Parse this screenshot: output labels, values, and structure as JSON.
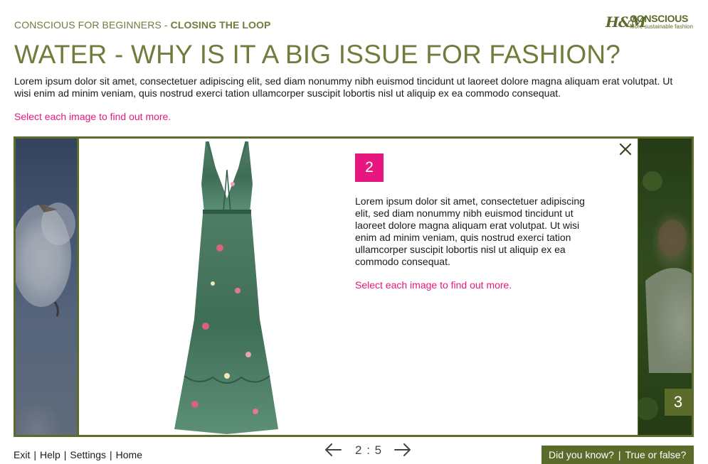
{
  "header": {
    "course": "CONSCIOUS FOR BEGINNERS",
    "separator": " - ",
    "module": "CLOSING THE LOOP",
    "logo_hm": "H&M",
    "logo_brand": "CONSCIOUS",
    "logo_tagline": "More sustainable fashion"
  },
  "page": {
    "title": "WATER - WHY IS IT A BIG ISSUE FOR FASHION?",
    "intro": "Lorem ipsum dolor sit amet, consectetuer adipiscing elit, sed diam nonummy nibh euismod tincidunt ut laoreet dolore magna aliquam erat volutpat. Ut wisi enim ad minim veniam, quis nostrud exerci tation ullamcorper suscipit lobortis nisl ut aliquip ex ea commodo consequat.",
    "hint": "Select each image to find out more."
  },
  "carousel": {
    "active_number": "2",
    "next_number": "3",
    "panel_text": "Lorem ipsum dolor sit amet, consectetuer adipiscing elit, sed diam nonummy nibh euismod tincidunt ut laoreet dolore magna aliquam erat volutpat. Ut wisi enim ad minim veniam, quis nostrud exerci tation ullamcorper suscipit lobortis nisl ut aliquip ex ea commodo consequat.",
    "panel_hint": "Select each image to find out more.",
    "close_icon": "close-icon",
    "colors": {
      "frame": "#5b6b2a",
      "accent": "#e6177e",
      "heading": "#6f7d3c"
    }
  },
  "footer": {
    "links": [
      "Exit",
      "Help",
      "Settings",
      "Home"
    ],
    "divider": "|",
    "pager": {
      "current": "2",
      "separator": ":",
      "total": "5"
    },
    "quiz_links": [
      "Did you know?",
      "True or false?"
    ]
  }
}
